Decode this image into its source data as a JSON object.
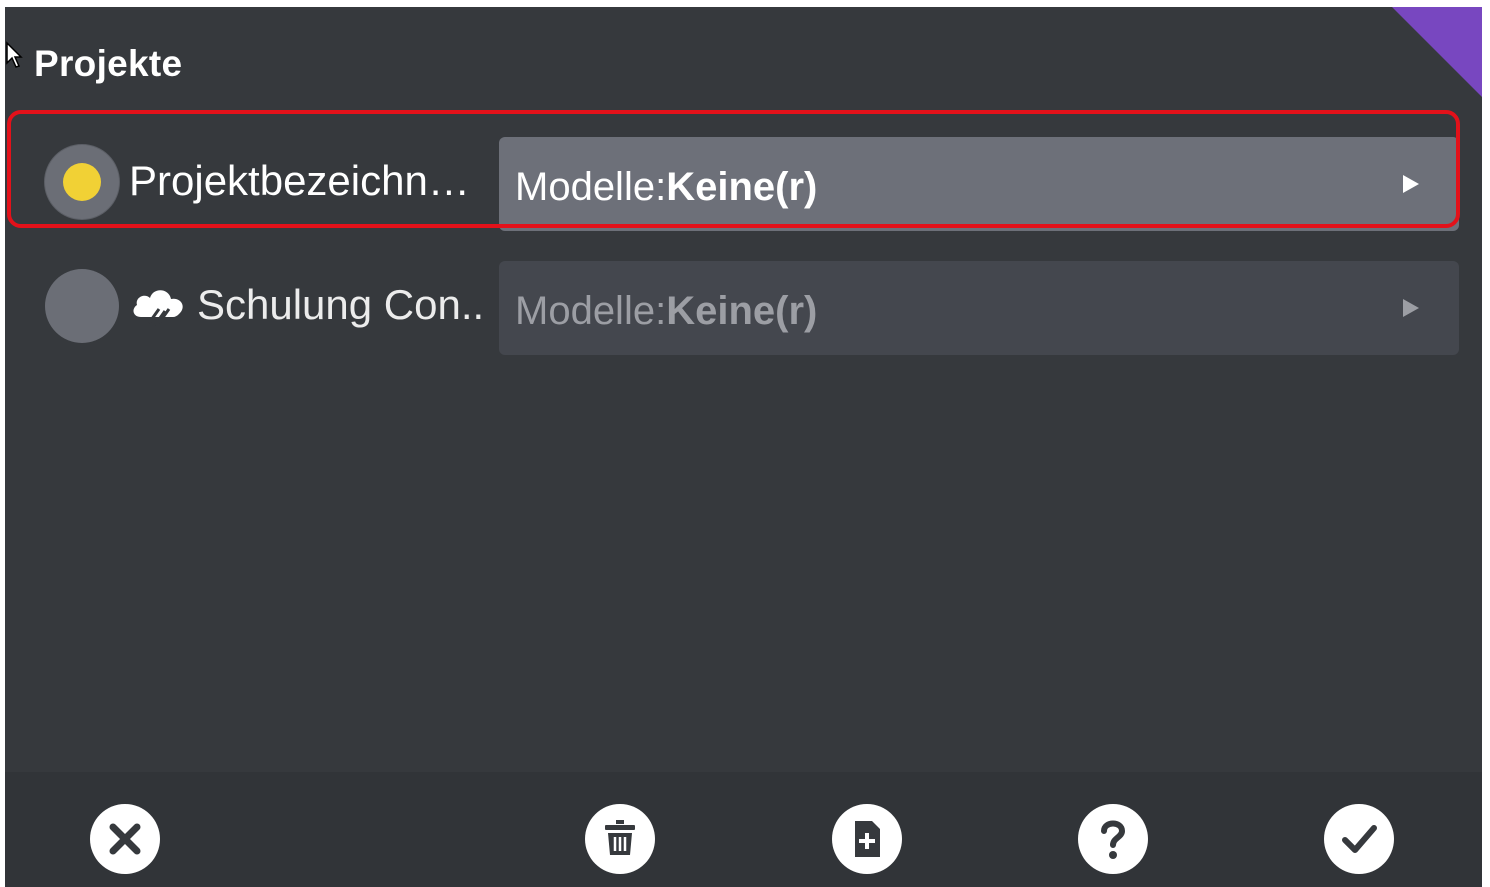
{
  "dialog": {
    "title": "Projekte"
  },
  "projects": [
    {
      "name": "Projektbezeichn…",
      "selected": true,
      "cloud": false,
      "models_label": "Modelle:",
      "models_value": "Keine(r)"
    },
    {
      "name": "Schulung Con..",
      "selected": false,
      "cloud": true,
      "models_label": "Modelle:",
      "models_value": "Keine(r)"
    }
  ],
  "toolbar": {
    "icons": [
      "close-icon",
      "trash-icon",
      "add-document-icon",
      "help-icon",
      "check-icon"
    ]
  },
  "colors": {
    "background": "#36393d",
    "selected_dot": "#f1d135",
    "highlight_border": "#e3111a",
    "corner_accent": "#7847c0"
  }
}
